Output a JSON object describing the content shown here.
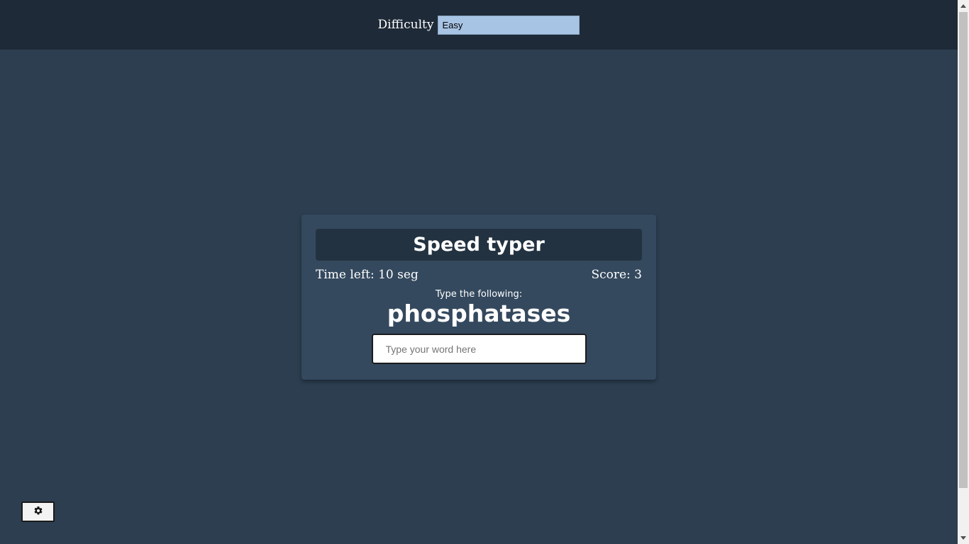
{
  "header": {
    "difficulty_label": "Difficulty",
    "difficulty_selected": "Easy"
  },
  "game": {
    "title": "Speed typer",
    "time_left": "Time left: 10 seg",
    "score": "Score: 3",
    "prompt": "Type the following:",
    "word": "phosphatases",
    "input_placeholder": "Type your word here",
    "input_value": ""
  },
  "settings": {
    "icon": "gear-icon"
  },
  "colors": {
    "background": "#2c3e50",
    "topbar": "#1f2a38",
    "card": "#34495e",
    "title_bar": "#233241",
    "select_bg": "#a8c4e4"
  }
}
